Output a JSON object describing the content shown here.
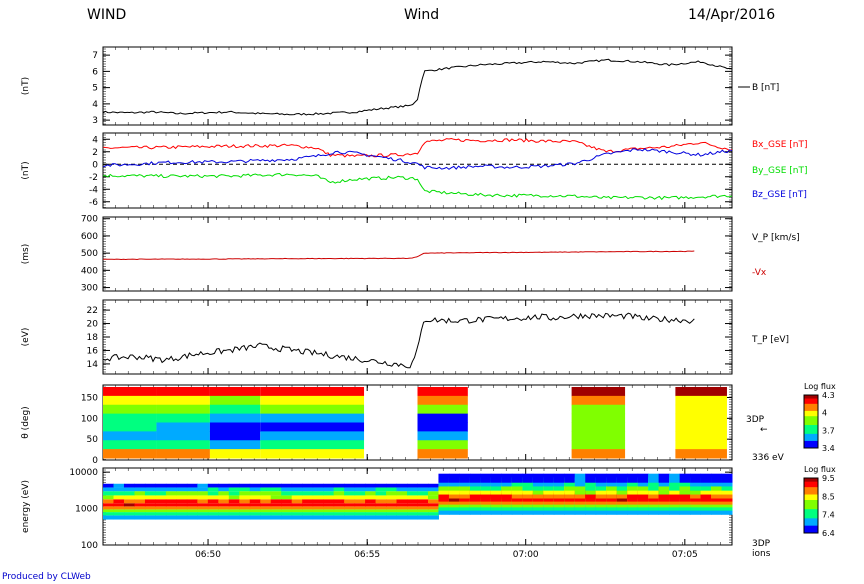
{
  "header": {
    "left": "WIND",
    "center": "Wind",
    "right": "14/Apr/2016"
  },
  "credit": "Produced by CLWeb",
  "chart_data": [
    {
      "type": "line",
      "panel": "B",
      "ylabel": "(nT)",
      "yticks": [
        3,
        4,
        5,
        6,
        7
      ],
      "ylim": [
        2.7,
        7.5
      ],
      "series": [
        {
          "name": "B [nT]",
          "color": "#000000",
          "x": [
            0,
            0.04,
            0.08,
            0.12,
            0.16,
            0.2,
            0.25,
            0.3,
            0.35,
            0.4,
            0.44,
            0.49,
            0.5,
            0.51,
            0.55,
            0.6,
            0.65,
            0.7,
            0.75,
            0.8,
            0.85,
            0.9,
            0.95,
            1.0
          ],
          "values": [
            3.5,
            3.45,
            3.5,
            3.4,
            3.45,
            3.5,
            3.4,
            3.35,
            3.4,
            3.5,
            3.7,
            3.9,
            4.3,
            6.0,
            6.2,
            6.4,
            6.5,
            6.6,
            6.5,
            6.7,
            6.6,
            6.4,
            6.6,
            6.1
          ]
        }
      ]
    },
    {
      "type": "line",
      "panel": "B components",
      "ylabel": "(nT)",
      "yticks": [
        -6,
        -4,
        -2,
        0,
        2,
        4
      ],
      "ylim": [
        -7,
        5
      ],
      "series": [
        {
          "name": "Bx_GSE [nT]",
          "color": "#ff0000",
          "x": [
            0,
            0.1,
            0.2,
            0.3,
            0.34,
            0.36,
            0.4,
            0.47,
            0.5,
            0.51,
            0.55,
            0.6,
            0.65,
            0.7,
            0.75,
            0.8,
            0.85,
            0.9,
            0.95,
            1.0
          ],
          "values": [
            2.6,
            2.7,
            2.9,
            3.0,
            2.6,
            1.5,
            1.3,
            1.5,
            1.8,
            3.6,
            3.9,
            3.8,
            3.9,
            3.7,
            3.6,
            2.0,
            2.5,
            2.8,
            3.5,
            2.3
          ]
        },
        {
          "name": "By_GSE [nT]",
          "color": "#00dd00",
          "x": [
            0,
            0.1,
            0.2,
            0.3,
            0.34,
            0.36,
            0.4,
            0.47,
            0.5,
            0.51,
            0.55,
            0.6,
            0.65,
            0.7,
            0.75,
            0.8,
            0.85,
            0.9,
            0.95,
            1.0
          ],
          "values": [
            -1.8,
            -1.9,
            -1.9,
            -1.6,
            -1.9,
            -2.9,
            -2.4,
            -2.1,
            -2.3,
            -4.3,
            -4.6,
            -4.9,
            -5.0,
            -5.0,
            -5.1,
            -5.4,
            -5.3,
            -5.4,
            -5.2,
            -5.0
          ]
        },
        {
          "name": "Bz_GSE [nT]",
          "color": "#0000dd",
          "x": [
            0,
            0.05,
            0.1,
            0.2,
            0.3,
            0.34,
            0.37,
            0.4,
            0.47,
            0.5,
            0.51,
            0.55,
            0.6,
            0.65,
            0.7,
            0.75,
            0.8,
            0.85,
            0.9,
            0.95,
            1.0
          ],
          "values": [
            -0.2,
            0.0,
            0.3,
            0.4,
            0.8,
            1.3,
            2.0,
            1.8,
            0.7,
            0.1,
            -0.5,
            -0.6,
            -0.3,
            -0.5,
            -0.3,
            0.1,
            1.6,
            2.4,
            2.0,
            1.5,
            2.2
          ]
        }
      ]
    },
    {
      "type": "line",
      "panel": "V_P",
      "ylabel": "(ms)",
      "yticks": [
        300,
        400,
        500,
        600,
        700
      ],
      "ylim": [
        280,
        710
      ],
      "series": [
        {
          "name": "V_P [km/s]",
          "color": "#cc0000",
          "x": [
            0,
            0.1,
            0.2,
            0.3,
            0.4,
            0.49,
            0.5,
            0.51,
            0.6,
            0.7,
            0.8,
            0.9,
            0.94
          ],
          "values": [
            464,
            465,
            466,
            468,
            469,
            470,
            478,
            500,
            503,
            505,
            508,
            510,
            511
          ]
        }
      ],
      "legend_extra": "-Vx"
    },
    {
      "type": "line",
      "panel": "T_P",
      "ylabel": "(eV)",
      "yticks": [
        14,
        16,
        18,
        20,
        22
      ],
      "ylim": [
        12.5,
        23.5
      ],
      "series": [
        {
          "name": "T_P [eV]",
          "color": "#000000",
          "x": [
            0,
            0.05,
            0.1,
            0.15,
            0.2,
            0.25,
            0.247,
            0.49,
            0.5,
            0.51,
            0.56,
            0.7,
            0.71,
            0.76,
            0.84,
            0.86,
            0.91,
            0.94
          ],
          "values": [
            14.8,
            15.1,
            14.6,
            15.5,
            16.0,
            16.7,
            16.7,
            13.7,
            16.0,
            20.6,
            20.4,
            21.0,
            20.8,
            21.2,
            21.1,
            20.7,
            20.6,
            20.4
          ]
        }
      ]
    },
    {
      "type": "heatmap",
      "panel": "3DP 336 eV pitch angle",
      "ylabel": "θ (deg)",
      "yticks": [
        0,
        50,
        100,
        150
      ],
      "ylim": [
        0,
        180
      ],
      "label": "3DP",
      "label_sub": "336 eV",
      "colorbar": {
        "title": "Log flux",
        "ticks": [
          3.4,
          3.7,
          4.0,
          4.3
        ]
      }
    },
    {
      "type": "heatmap",
      "panel": "3DP ions energy",
      "ylabel": "energy (eV)",
      "yticks": [
        100,
        1000,
        10000
      ],
      "yscale": "log",
      "label": "3DP",
      "label_sub": "ions",
      "colorbar": {
        "title": "Log flux",
        "ticks": [
          6.4,
          7.4,
          8.5,
          9.5
        ]
      }
    }
  ],
  "x_axis": {
    "ticks": [
      "06:50",
      "06:55",
      "07:00",
      "07:05"
    ]
  }
}
